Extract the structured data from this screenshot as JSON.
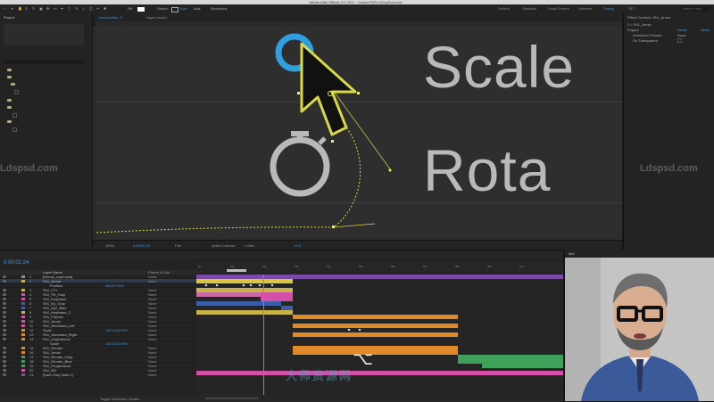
{
  "window": {
    "title": "Adobe After Effects CC 2017 - /Users/TDFLO/Dry/Docume..."
  },
  "toolbar": {
    "fill_label": "Fill:",
    "stroke_label": "Stroke:",
    "stroke_width": "5 px",
    "add_label": "Add:",
    "bevel_label": "Bevelcolor",
    "workspaces": [
      "Default",
      "Standard",
      "Small Screen",
      "Libraries",
      "Tracky",
      "TBT"
    ],
    "active_workspace": "Tracky",
    "search_placeholder": "Search Help"
  },
  "project": {
    "title": "Project"
  },
  "viewer": {
    "tabs": [
      "Composition: 2",
      "Layer (none)"
    ],
    "words": [
      "Scale",
      "Rota"
    ],
    "footer": {
      "zoom": "100%",
      "timecode": "0;00;02;24",
      "resolution": "Full",
      "camera": "Active Camera",
      "views": "1 View",
      "exposure": "+0.0"
    }
  },
  "effects": {
    "title": "Effect Controls: Sh1_Arrow",
    "breadcrumb": "2 > Sh1_Arrow",
    "effect_name": "Puppet",
    "reset_label": "Reset",
    "about_label": "About",
    "mesh_label": "Animation Presets",
    "mesh_value": "None",
    "option_label": "On Transparent"
  },
  "timeline": {
    "timecode": "0;00;02;24",
    "col_name": "Layer Name",
    "col_mode": "Parent & Link",
    "layers": [
      {
        "num": "1",
        "name": "[Nomal_Layer.psd]",
        "mode": "None",
        "color": "#8a8a8a"
      },
      {
        "num": "2",
        "name": "Sh1_Arrow",
        "mode": "None",
        "color": "#c9b24a"
      },
      {
        "num": "",
        "name": "Position",
        "mode": "",
        "color": "",
        "value": "964.5,796.5"
      },
      {
        "num": "3",
        "name": "Sh1_CTI",
        "mode": "None",
        "color": "#c9b24a"
      },
      {
        "num": "4",
        "name": "Sh1_Ptt_Gray",
        "mode": "None",
        "color": "#d34fa8"
      },
      {
        "num": "5",
        "name": "Sh1_Keyframe",
        "mode": "None",
        "color": "#d34fa8"
      },
      {
        "num": "6",
        "name": "Sh1_Ky_Gray",
        "mode": "None",
        "color": "#3a5fa8"
      },
      {
        "num": "7",
        "name": "Sh1_Ky2_Blue",
        "mode": "None",
        "color": "#3a5fa8"
      },
      {
        "num": "8",
        "name": "Sh1_Keyframe_2",
        "mode": "None",
        "color": "#c9b24a"
      },
      {
        "num": "9",
        "name": "Sh1_Frames",
        "mode": "None",
        "color": "#d34fa8"
      },
      {
        "num": "10",
        "name": "Sh1_Arrow",
        "mode": "None",
        "color": "#d34fa8"
      },
      {
        "num": "11",
        "name": "Sh1_Workarea_Left",
        "mode": "None",
        "color": "#d34fa8"
      },
      {
        "num": "12",
        "name": "Scale",
        "mode": "None",
        "color": "#e08a2a",
        "value": "100.0,100.0%"
      },
      {
        "num": "13",
        "name": "Sh1_Workarea_Right",
        "mode": "None",
        "color": "#e08a2a"
      },
      {
        "num": "14",
        "name": "Sh1_Keyframes2",
        "mode": "None",
        "color": "#e08a2a"
      },
      {
        "num": "",
        "name": "Scale",
        "mode": "",
        "color": "",
        "value": "100.0,100.0%"
      },
      {
        "num": "15",
        "name": "Sh1_Render",
        "mode": "None",
        "color": "#e08a2a"
      },
      {
        "num": "16",
        "name": "Sh1_Arrow",
        "mode": "None",
        "color": "#e08a2a"
      },
      {
        "num": "17",
        "name": "Sh1_Render_Gray",
        "mode": "None",
        "color": "#3fa05a"
      },
      {
        "num": "18",
        "name": "Sh1_Render_Blue",
        "mode": "None",
        "color": "#3fa05a"
      },
      {
        "num": "19",
        "name": "Sh1_Progressbar",
        "mode": "None",
        "color": "#3fa05a"
      },
      {
        "num": "20",
        "name": "Sh1_BG",
        "mode": "None",
        "color": "#d34fa8"
      },
      {
        "num": "21",
        "name": "[Dark Gray Solid 1]",
        "mode": "None",
        "color": "#8a4ab0"
      }
    ],
    "ruler_ticks": [
      "0s",
      "01s",
      "02s",
      "03s",
      "04s",
      "05s",
      "06s",
      "07s",
      "08s",
      "09s",
      "10s"
    ],
    "footer_label": "Toggle Switches / Modes"
  },
  "webcam": {
    "title": "Mel"
  },
  "watermarks": {
    "left": "Ldspsd.com",
    "right": "Ldspsd.com",
    "cn": "大师资源网"
  },
  "glyph": "⌥"
}
